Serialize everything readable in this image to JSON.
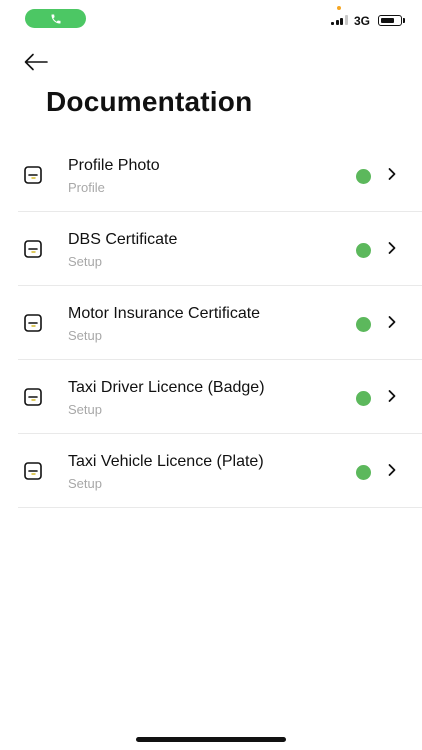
{
  "status_bar": {
    "network": "3G",
    "signal_bars_active": 3,
    "colors": {
      "call_pill": "#4cc764",
      "privacy_dot": "#f5a623"
    }
  },
  "header": {
    "title": "Documentation"
  },
  "documents": [
    {
      "title": "Profile Photo",
      "subtitle": "Profile",
      "status_color": "#5cb85c"
    },
    {
      "title": "DBS Certificate",
      "subtitle": "Setup",
      "status_color": "#5cb85c"
    },
    {
      "title": "Motor Insurance Certificate",
      "subtitle": "Setup",
      "status_color": "#5cb85c"
    },
    {
      "title": "Taxi Driver Licence (Badge)",
      "subtitle": "Setup",
      "status_color": "#5cb85c"
    },
    {
      "title": "Taxi Vehicle Licence (Plate)",
      "subtitle": "Setup",
      "status_color": "#5cb85c"
    }
  ],
  "icons": {
    "back": "arrow-left-icon",
    "row": "document-icon",
    "row_arrow": "chevron-right-icon",
    "call": "phone-icon"
  }
}
